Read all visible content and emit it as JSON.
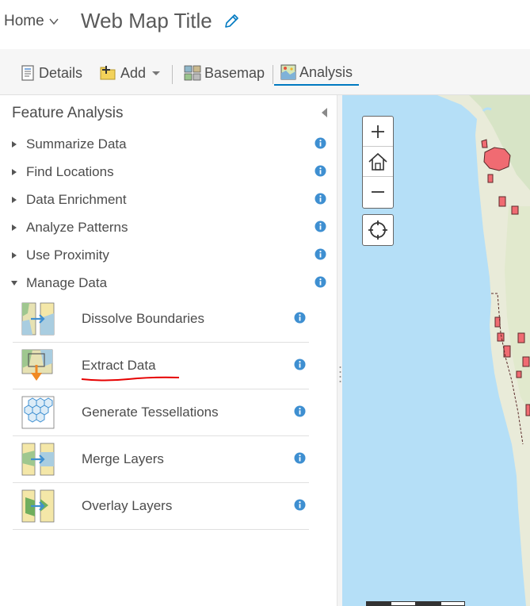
{
  "header": {
    "home_label": "Home",
    "map_title": "Web Map Title"
  },
  "toolbar": {
    "details_label": "Details",
    "add_label": "Add",
    "basemap_label": "Basemap",
    "analysis_label": "Analysis",
    "active_tab": "Analysis"
  },
  "panel": {
    "title": "Feature Analysis",
    "categories": [
      {
        "label": "Summarize Data",
        "expanded": false
      },
      {
        "label": "Find Locations",
        "expanded": false
      },
      {
        "label": "Data Enrichment",
        "expanded": false
      },
      {
        "label": "Analyze Patterns",
        "expanded": false
      },
      {
        "label": "Use Proximity",
        "expanded": false
      },
      {
        "label": "Manage Data",
        "expanded": true
      }
    ],
    "tools": [
      {
        "label": "Dissolve Boundaries",
        "icon": "dissolve-boundaries-icon"
      },
      {
        "label": "Extract Data",
        "icon": "extract-data-icon"
      },
      {
        "label": "Generate Tessellations",
        "icon": "generate-tessellations-icon"
      },
      {
        "label": "Merge Layers",
        "icon": "merge-layers-icon"
      },
      {
        "label": "Overlay Layers",
        "icon": "overlay-layers-icon"
      }
    ]
  },
  "colors": {
    "accent": "#0079c1",
    "info": "#3e8fd1",
    "water": "#b5dff7",
    "land": "#e9ebd9",
    "feature": "#f06b72",
    "annotation": "#e60000"
  }
}
